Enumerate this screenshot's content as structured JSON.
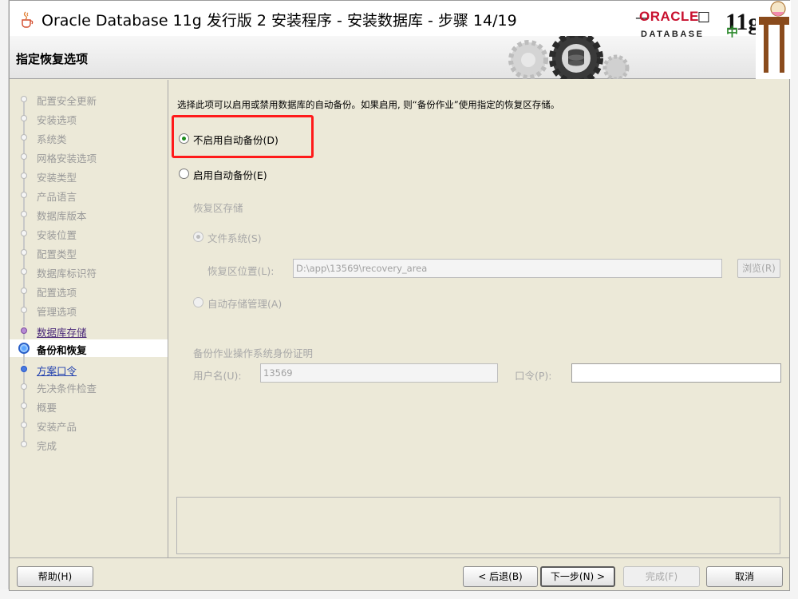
{
  "window": {
    "title": "Oracle Database 11g 发行版 2 安装程序 - 安装数据库 - 步骤 14/19",
    "minimize_glyph": "—",
    "maximize_glyph": "☐",
    "close_glyph": "✕"
  },
  "header": {
    "page_title": "指定恢复选项",
    "brand_oracle": "ORACLE",
    "brand_database": "DATABASE",
    "brand_version": "11g",
    "ime_badge": "中"
  },
  "steps": [
    {
      "label": "配置安全更新",
      "state": "done"
    },
    {
      "label": "安装选项",
      "state": "done"
    },
    {
      "label": "系统类",
      "state": "done"
    },
    {
      "label": "网格安装选项",
      "state": "done"
    },
    {
      "label": "安装类型",
      "state": "done"
    },
    {
      "label": "产品语言",
      "state": "done"
    },
    {
      "label": "数据库版本",
      "state": "done"
    },
    {
      "label": "安装位置",
      "state": "done"
    },
    {
      "label": "配置类型",
      "state": "done"
    },
    {
      "label": "数据库标识符",
      "state": "done"
    },
    {
      "label": "配置选项",
      "state": "done"
    },
    {
      "label": "管理选项",
      "state": "done"
    },
    {
      "label": "数据库存储",
      "state": "visited"
    },
    {
      "label": "备份和恢复",
      "state": "current"
    },
    {
      "label": "方案口令",
      "state": "next"
    },
    {
      "label": "先决条件检查",
      "state": "pending"
    },
    {
      "label": "概要",
      "state": "pending"
    },
    {
      "label": "安装产品",
      "state": "pending"
    },
    {
      "label": "完成",
      "state": "pending"
    }
  ],
  "main": {
    "description": "选择此项可以启用或禁用数据库的自动备份。如果启用, 则“备份作业”使用指定的恢复区存储。",
    "option_disable": "不启用自动备份(D)",
    "option_enable": "启用自动备份(E)",
    "selected_option": "不启用自动备份(D)",
    "recovery_storage_title": "恢复区存储",
    "file_system_label": "文件系统(S)",
    "recovery_location_label": "恢复区位置(L):",
    "recovery_location_value": "D:\\app\\13569\\recovery_area",
    "browse_button": "浏览(R)",
    "asm_label": "自动存储管理(A)",
    "credentials_title": "备份作业操作系统身份证明",
    "username_label": "用户名(U):",
    "username_value": "13569",
    "password_label": "口令(P):",
    "password_value": ""
  },
  "buttons": {
    "help": "帮助(H)",
    "back": "< 后退(B)",
    "next": "下一步(N) >",
    "finish": "完成(F)",
    "cancel": "取消"
  },
  "colors": {
    "highlight_box": "#ff1a1a",
    "oracle_red": "#c8102e",
    "selected_radio": "#1d8c1d",
    "current_step_bg": "#ffffff",
    "window_bg": "#ece9d8"
  }
}
